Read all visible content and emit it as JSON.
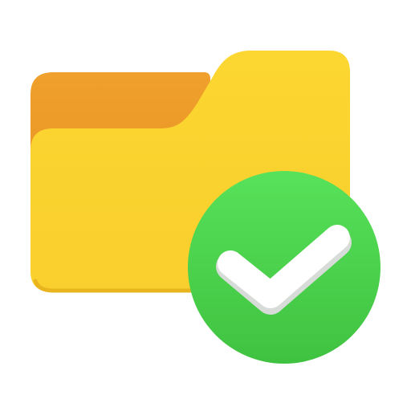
{
  "icon": {
    "main": "folder-icon",
    "badge": "checkmark-icon"
  },
  "colors": {
    "folder_back": "#F0A02C",
    "folder_back_shadow": "#E38E22",
    "folder_front": "#F9CF2D",
    "folder_front_light": "#FCD631",
    "folder_front_shadow": "#E9B51F",
    "badge": "#47D84B",
    "badge_light": "#58E15A",
    "badge_dark": "#3FC240",
    "check": "#FFFFFF",
    "check_shadow": "#D8DCD8"
  }
}
